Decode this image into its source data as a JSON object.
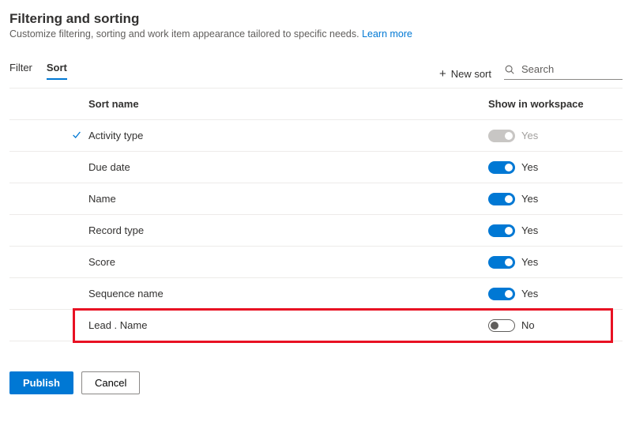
{
  "header": {
    "title": "Filtering and sorting",
    "subtitle_prefix": "Customize filtering, sorting and work item appearance tailored to specific needs. ",
    "learn_more": "Learn more"
  },
  "tabs": {
    "filter": "Filter",
    "sort": "Sort"
  },
  "toolbar": {
    "new_sort": "New sort",
    "search_placeholder": "Search"
  },
  "columns": {
    "sort_name": "Sort name",
    "show_in_workspace": "Show in workspace"
  },
  "toggle_text": {
    "yes": "Yes",
    "no": "No"
  },
  "rows": [
    {
      "name": "Activity type",
      "on": true,
      "disabled": true,
      "checked": true
    },
    {
      "name": "Due date",
      "on": true,
      "disabled": false,
      "checked": false
    },
    {
      "name": "Name",
      "on": true,
      "disabled": false,
      "checked": false
    },
    {
      "name": "Record type",
      "on": true,
      "disabled": false,
      "checked": false
    },
    {
      "name": "Score",
      "on": true,
      "disabled": false,
      "checked": false
    },
    {
      "name": "Sequence name",
      "on": true,
      "disabled": false,
      "checked": false
    },
    {
      "name": "Lead . Name",
      "on": false,
      "disabled": false,
      "checked": false,
      "highlight": true
    }
  ],
  "footer": {
    "publish": "Publish",
    "cancel": "Cancel"
  },
  "chart_data": {
    "type": "table",
    "title": "Sort configuration",
    "columns": [
      "Sort name",
      "Show in workspace"
    ],
    "rows": [
      [
        "Activity type",
        "Yes"
      ],
      [
        "Due date",
        "Yes"
      ],
      [
        "Name",
        "Yes"
      ],
      [
        "Record type",
        "Yes"
      ],
      [
        "Score",
        "Yes"
      ],
      [
        "Sequence name",
        "Yes"
      ],
      [
        "Lead . Name",
        "No"
      ]
    ]
  }
}
